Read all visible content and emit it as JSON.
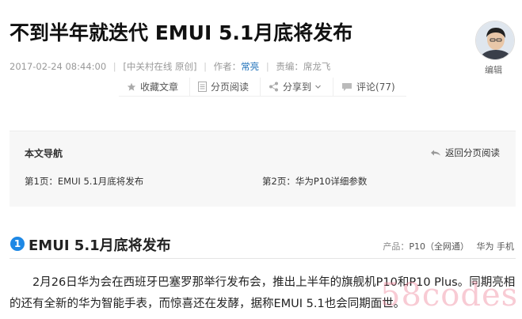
{
  "article": {
    "title": "不到半年就迭代 EMUI 5.1月底将发布",
    "date": "2017-02-24 08:44:00",
    "source": "[中关村在线 原创]",
    "author_label": "作者：",
    "author": "常亮",
    "editor_label": "责编：",
    "editor": "席龙飞"
  },
  "profile": {
    "label": "编辑"
  },
  "toolbar": {
    "favorite": "收藏文章",
    "paged_read": "分页阅读",
    "share": "分享到",
    "comment": "评论(77)"
  },
  "nav": {
    "title": "本文导航",
    "back": "返回分页阅读",
    "pages": [
      "第1页：EMUI 5.1月底将发布",
      "第2页：华为P10详细参数"
    ]
  },
  "section": {
    "number": "1",
    "title": "EMUI 5.1月底将发布",
    "product_label": "产品：",
    "product_value": "P10（全网通）",
    "brand": "华为 手机"
  },
  "body": {
    "paragraph": "2月26日华为会在西班牙巴塞罗那举行发布会，推出上半年的旗舰机P10和P10 Plus。同期亮相的还有全新的华为智能手表，而惊喜还在发酵，据称EMUI 5.1也会同期面世。"
  },
  "watermark": "58codes",
  "colors": {
    "accent": "#1e88e5",
    "link": "#1a6eb8"
  }
}
